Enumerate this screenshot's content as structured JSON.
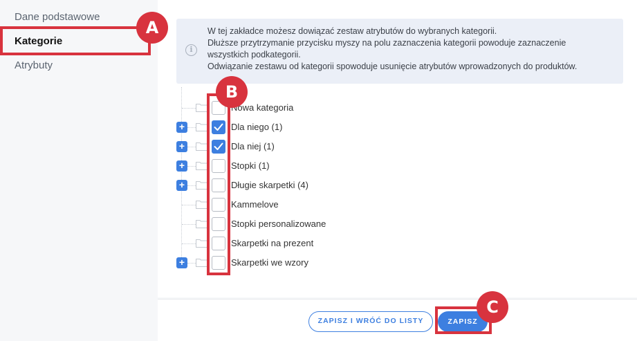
{
  "sidebar": {
    "items": [
      {
        "label": "Dane podstawowe",
        "active": false
      },
      {
        "label": "Kategorie",
        "active": true
      },
      {
        "label": "Atrybuty",
        "active": false
      }
    ]
  },
  "info": {
    "lines": [
      "W tej zakładce możesz dowiązać zestaw atrybutów do wybranych kategorii.",
      "Dłuższe przytrzymanie przycisku myszy na polu zaznaczenia kategorii powoduje zaznaczenie",
      "wszystkich podkategorii.",
      "Odwiązanie zestawu od kategorii spowoduje usunięcie atrybutów wprowadzonych do produktów."
    ]
  },
  "categories": [
    {
      "label": "Nowa kategoria",
      "checked": false,
      "expandable": false
    },
    {
      "label": "Dla niego (1)",
      "checked": true,
      "expandable": true
    },
    {
      "label": "Dla niej (1)",
      "checked": true,
      "expandable": true
    },
    {
      "label": "Stopki (1)",
      "checked": false,
      "expandable": true
    },
    {
      "label": "Długie skarpetki (4)",
      "checked": false,
      "expandable": true
    },
    {
      "label": "Kammelove",
      "checked": false,
      "expandable": false
    },
    {
      "label": "Stopki personalizowane",
      "checked": false,
      "expandable": false
    },
    {
      "label": "Skarpetki na prezent",
      "checked": false,
      "expandable": false
    },
    {
      "label": "Skarpetki we wzory",
      "checked": false,
      "expandable": true
    }
  ],
  "footer": {
    "save_and_back_label": "ZAPISZ I WRÓĆ DO LISTY",
    "save_label": "ZAPISZ"
  },
  "annotations": {
    "a": "A",
    "b": "B",
    "c": "C"
  },
  "colors": {
    "accent": "#3d7fe0",
    "highlight": "#d8333e",
    "info_bg": "#ebeff7"
  }
}
